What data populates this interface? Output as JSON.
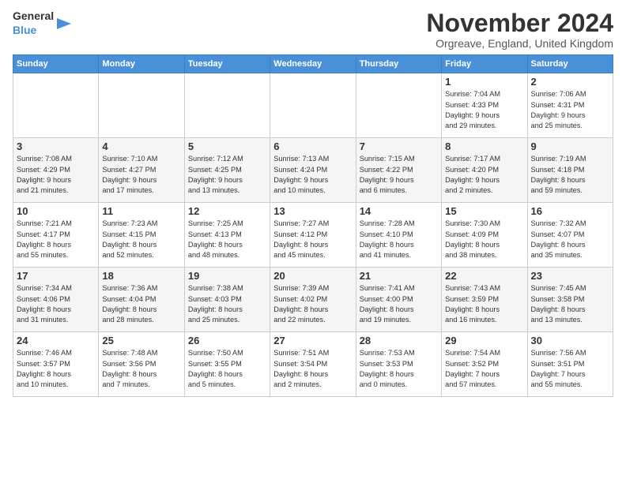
{
  "header": {
    "logo_general": "General",
    "logo_blue": "Blue",
    "month_title": "November 2024",
    "location": "Orgreave, England, United Kingdom"
  },
  "weekdays": [
    "Sunday",
    "Monday",
    "Tuesday",
    "Wednesday",
    "Thursday",
    "Friday",
    "Saturday"
  ],
  "weeks": [
    [
      {
        "day": "",
        "info": ""
      },
      {
        "day": "",
        "info": ""
      },
      {
        "day": "",
        "info": ""
      },
      {
        "day": "",
        "info": ""
      },
      {
        "day": "",
        "info": ""
      },
      {
        "day": "1",
        "info": "Sunrise: 7:04 AM\nSunset: 4:33 PM\nDaylight: 9 hours\nand 29 minutes."
      },
      {
        "day": "2",
        "info": "Sunrise: 7:06 AM\nSunset: 4:31 PM\nDaylight: 9 hours\nand 25 minutes."
      }
    ],
    [
      {
        "day": "3",
        "info": "Sunrise: 7:08 AM\nSunset: 4:29 PM\nDaylight: 9 hours\nand 21 minutes."
      },
      {
        "day": "4",
        "info": "Sunrise: 7:10 AM\nSunset: 4:27 PM\nDaylight: 9 hours\nand 17 minutes."
      },
      {
        "day": "5",
        "info": "Sunrise: 7:12 AM\nSunset: 4:25 PM\nDaylight: 9 hours\nand 13 minutes."
      },
      {
        "day": "6",
        "info": "Sunrise: 7:13 AM\nSunset: 4:24 PM\nDaylight: 9 hours\nand 10 minutes."
      },
      {
        "day": "7",
        "info": "Sunrise: 7:15 AM\nSunset: 4:22 PM\nDaylight: 9 hours\nand 6 minutes."
      },
      {
        "day": "8",
        "info": "Sunrise: 7:17 AM\nSunset: 4:20 PM\nDaylight: 9 hours\nand 2 minutes."
      },
      {
        "day": "9",
        "info": "Sunrise: 7:19 AM\nSunset: 4:18 PM\nDaylight: 8 hours\nand 59 minutes."
      }
    ],
    [
      {
        "day": "10",
        "info": "Sunrise: 7:21 AM\nSunset: 4:17 PM\nDaylight: 8 hours\nand 55 minutes."
      },
      {
        "day": "11",
        "info": "Sunrise: 7:23 AM\nSunset: 4:15 PM\nDaylight: 8 hours\nand 52 minutes."
      },
      {
        "day": "12",
        "info": "Sunrise: 7:25 AM\nSunset: 4:13 PM\nDaylight: 8 hours\nand 48 minutes."
      },
      {
        "day": "13",
        "info": "Sunrise: 7:27 AM\nSunset: 4:12 PM\nDaylight: 8 hours\nand 45 minutes."
      },
      {
        "day": "14",
        "info": "Sunrise: 7:28 AM\nSunset: 4:10 PM\nDaylight: 8 hours\nand 41 minutes."
      },
      {
        "day": "15",
        "info": "Sunrise: 7:30 AM\nSunset: 4:09 PM\nDaylight: 8 hours\nand 38 minutes."
      },
      {
        "day": "16",
        "info": "Sunrise: 7:32 AM\nSunset: 4:07 PM\nDaylight: 8 hours\nand 35 minutes."
      }
    ],
    [
      {
        "day": "17",
        "info": "Sunrise: 7:34 AM\nSunset: 4:06 PM\nDaylight: 8 hours\nand 31 minutes."
      },
      {
        "day": "18",
        "info": "Sunrise: 7:36 AM\nSunset: 4:04 PM\nDaylight: 8 hours\nand 28 minutes."
      },
      {
        "day": "19",
        "info": "Sunrise: 7:38 AM\nSunset: 4:03 PM\nDaylight: 8 hours\nand 25 minutes."
      },
      {
        "day": "20",
        "info": "Sunrise: 7:39 AM\nSunset: 4:02 PM\nDaylight: 8 hours\nand 22 minutes."
      },
      {
        "day": "21",
        "info": "Sunrise: 7:41 AM\nSunset: 4:00 PM\nDaylight: 8 hours\nand 19 minutes."
      },
      {
        "day": "22",
        "info": "Sunrise: 7:43 AM\nSunset: 3:59 PM\nDaylight: 8 hours\nand 16 minutes."
      },
      {
        "day": "23",
        "info": "Sunrise: 7:45 AM\nSunset: 3:58 PM\nDaylight: 8 hours\nand 13 minutes."
      }
    ],
    [
      {
        "day": "24",
        "info": "Sunrise: 7:46 AM\nSunset: 3:57 PM\nDaylight: 8 hours\nand 10 minutes."
      },
      {
        "day": "25",
        "info": "Sunrise: 7:48 AM\nSunset: 3:56 PM\nDaylight: 8 hours\nand 7 minutes."
      },
      {
        "day": "26",
        "info": "Sunrise: 7:50 AM\nSunset: 3:55 PM\nDaylight: 8 hours\nand 5 minutes."
      },
      {
        "day": "27",
        "info": "Sunrise: 7:51 AM\nSunset: 3:54 PM\nDaylight: 8 hours\nand 2 minutes."
      },
      {
        "day": "28",
        "info": "Sunrise: 7:53 AM\nSunset: 3:53 PM\nDaylight: 8 hours\nand 0 minutes."
      },
      {
        "day": "29",
        "info": "Sunrise: 7:54 AM\nSunset: 3:52 PM\nDaylight: 7 hours\nand 57 minutes."
      },
      {
        "day": "30",
        "info": "Sunrise: 7:56 AM\nSunset: 3:51 PM\nDaylight: 7 hours\nand 55 minutes."
      }
    ]
  ]
}
